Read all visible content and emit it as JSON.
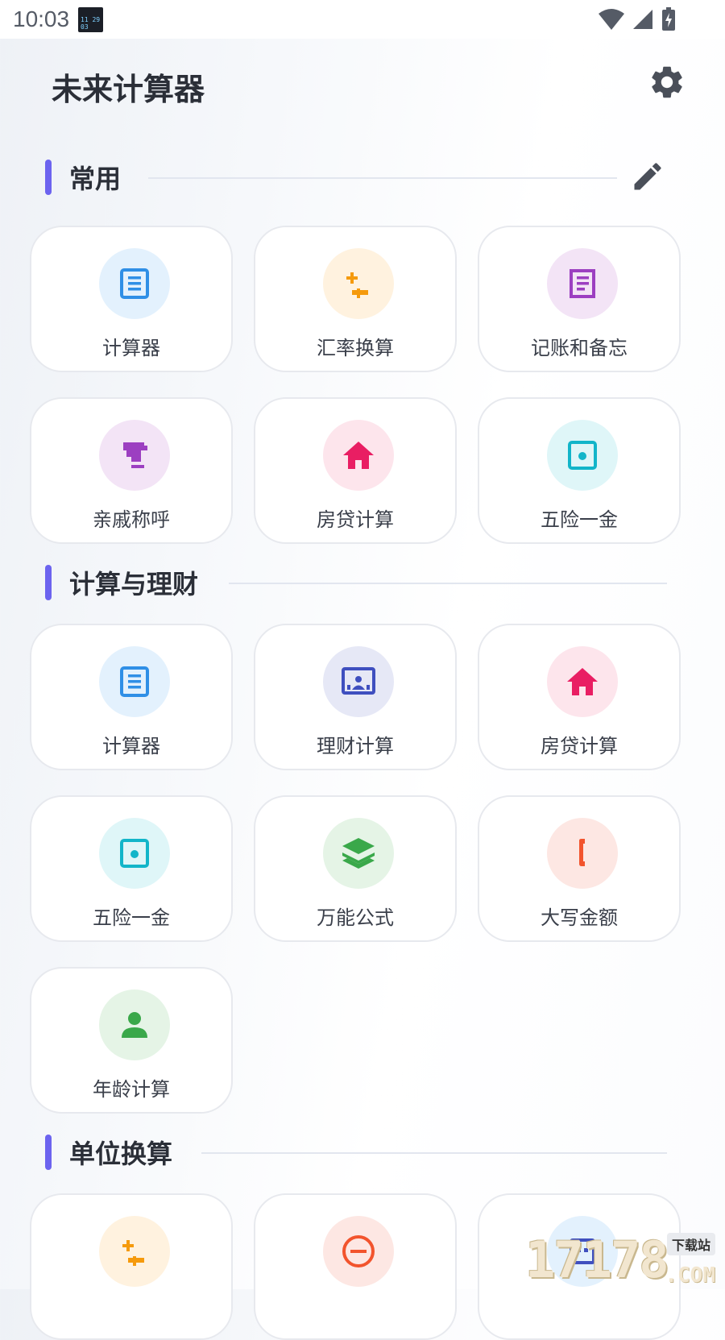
{
  "status_bar": {
    "time": "10:03",
    "thumb_text": "11 29 03"
  },
  "header": {
    "title": "未来计算器"
  },
  "sections": {
    "common": {
      "title": "常用",
      "tiles": [
        {
          "label": "计算器"
        },
        {
          "label": "汇率换算"
        },
        {
          "label": "记账和备忘"
        },
        {
          "label": "亲戚称呼"
        },
        {
          "label": "房贷计算"
        },
        {
          "label": "五险一金"
        }
      ]
    },
    "finance": {
      "title": "计算与理财",
      "tiles": [
        {
          "label": "计算器"
        },
        {
          "label": "理财计算"
        },
        {
          "label": "房贷计算"
        },
        {
          "label": "五险一金"
        },
        {
          "label": "万能公式"
        },
        {
          "label": "大写金额"
        },
        {
          "label": "年龄计算"
        }
      ]
    },
    "units": {
      "title": "单位换算"
    }
  },
  "colors": {
    "accent": "#6c63ef",
    "blue": "#2f8fe6",
    "orange": "#f59a0c",
    "purple": "#9c3fc1",
    "pink": "#e91e63",
    "cyan": "#12b5c9",
    "indigo": "#3f4fbf",
    "green": "#3aa84a",
    "red_orange": "#f2542d"
  },
  "watermark": {
    "digits": "17178",
    "com": ".COM",
    "tag": "下载站"
  }
}
